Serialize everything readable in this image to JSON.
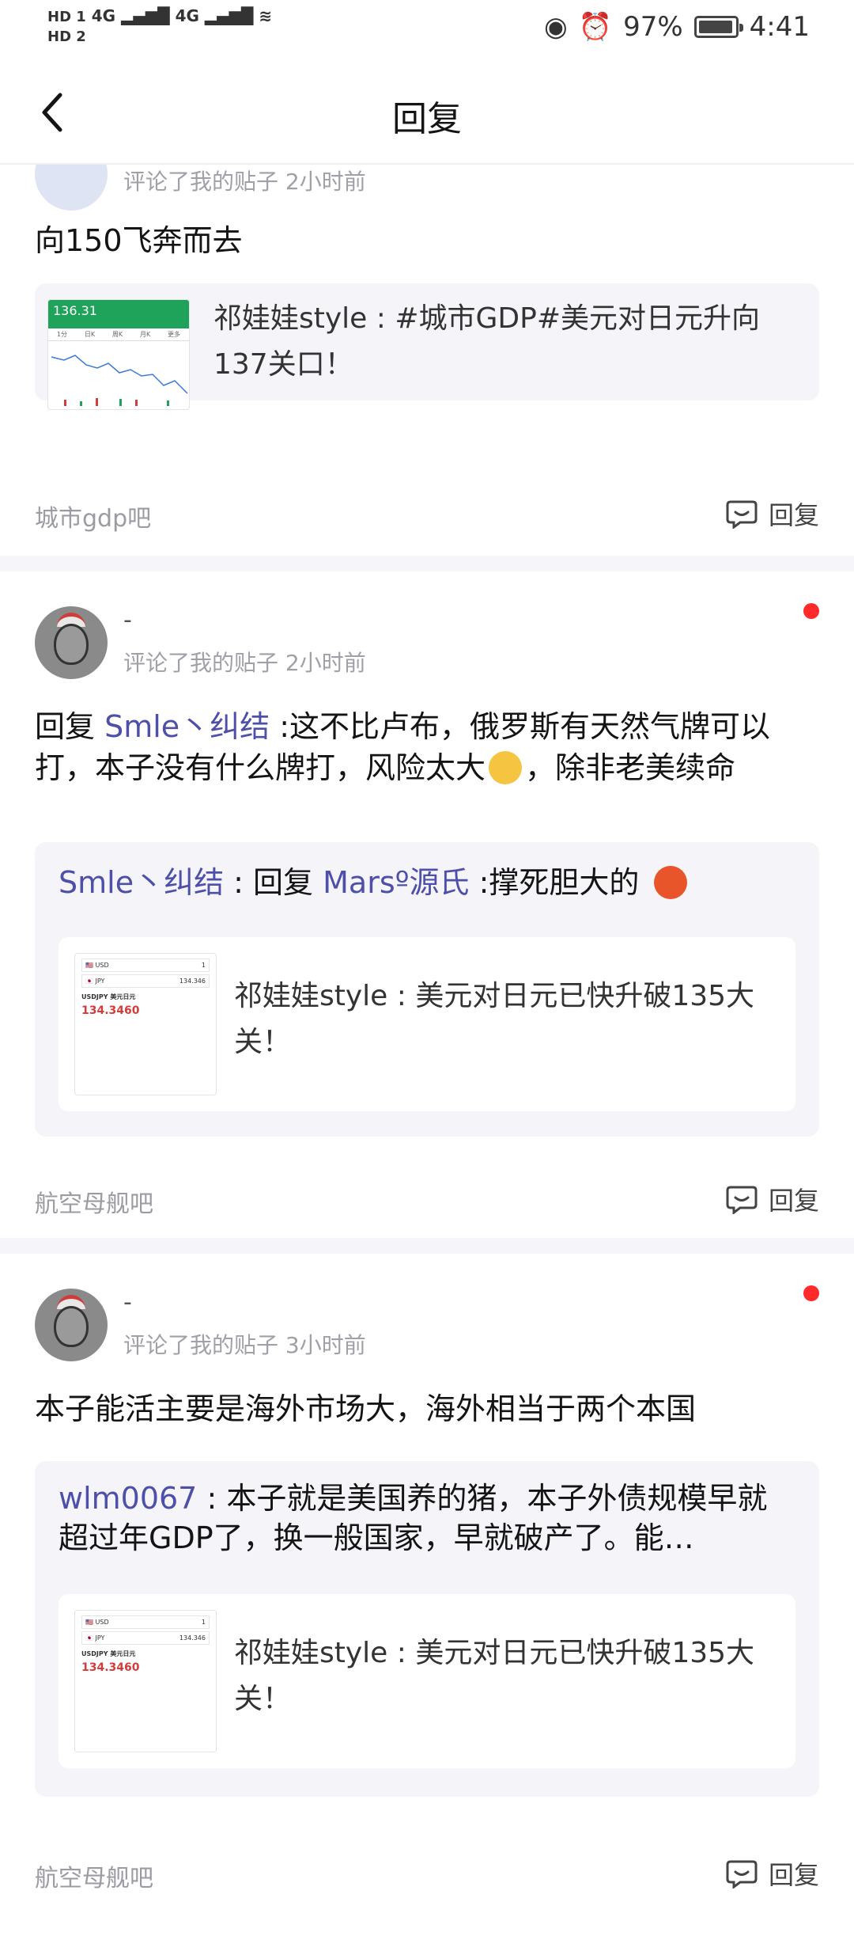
{
  "status_bar": {
    "hd1": "HD 1",
    "hd2": "HD 2",
    "net1": "4G",
    "net2": "4G",
    "battery": "97%",
    "time": "4:41"
  },
  "nav": {
    "title": "回复"
  },
  "cards": [
    {
      "meta": "评论了我的贴子  2小时前",
      "content": "向150飞奔而去",
      "thumb": {
        "price": "136.31",
        "tabs": [
          "1分",
          "日K",
          "周K",
          "月K",
          "更多"
        ]
      },
      "inner_text": "祁娃娃style : #城市GDP#美元对日元升向137关口！",
      "forum": "城市gdp吧",
      "reply_label": "回复"
    },
    {
      "username": "-",
      "meta": "评论了我的贴子  2小时前",
      "content_prefix": "回复 ",
      "content_mention": "Smle丶纠结",
      "content_body": " :这不比卢布，俄罗斯有天然气牌可以打，本子没有什么牌打，风险太大",
      "content_suffix": "，除非老美续命",
      "quote_author": "Smle丶纠结",
      "quote_mid": " : 回复 ",
      "quote_mention": "Marsº源氏",
      "quote_body": " :撑死胆大的",
      "thumb": {
        "pair": "USDJPY 美元日元",
        "price": "134.3460",
        "input1": "1",
        "input2": "134.346"
      },
      "inner_text": "祁娃娃style : 美元对日元已快升破135大关！",
      "forum": "航空母舰吧",
      "reply_label": "回复"
    },
    {
      "username": "-",
      "meta": "评论了我的贴子  3小时前",
      "content": "本子能活主要是海外市场大，海外相当于两个本国",
      "quote_author": "wlm0067",
      "quote_body": " : 本子就是美国养的猪，本子外债规模早就超过年GDP了，换一般国家，早就破产了。能…",
      "thumb": {
        "pair": "USDJPY 美元日元",
        "price": "134.3460",
        "input1": "1",
        "input2": "134.346"
      },
      "inner_text": "祁娃娃style : 美元对日元已快升破135大关！",
      "forum": "航空母舰吧",
      "reply_label": "回复"
    }
  ],
  "colors": {
    "mention": "#4d4fa8",
    "unread_dot": "#ff2a2a",
    "chart_green": "#1fa35a"
  }
}
